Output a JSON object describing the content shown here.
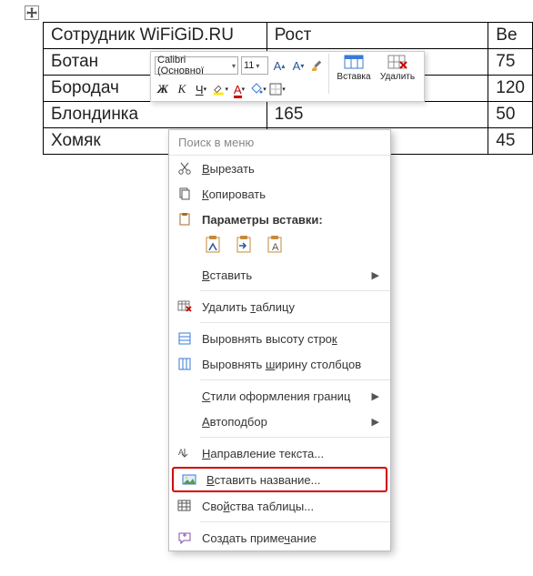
{
  "table": {
    "headers": [
      "Сотрудник WiFiGiD.RU",
      "Рост",
      "Ве"
    ],
    "rows": [
      {
        "c1": "Ботан",
        "c2": "",
        "c3": "75"
      },
      {
        "c1": "Бородач",
        "c2": "",
        "c3": "120"
      },
      {
        "c1": "Блондинка",
        "c2": "165",
        "c3": "50"
      },
      {
        "c1": "Хомяк",
        "c2": "",
        "c3": "45"
      }
    ]
  },
  "miniToolbar": {
    "font": "Calibri (Основної",
    "size": "11",
    "insert": "Вставка",
    "delete": "Удалить"
  },
  "contextMenu": {
    "search": "Поиск в меню",
    "cut": "Вырезать",
    "copy": "Копировать",
    "pasteOptionsTitle": "Параметры вставки:",
    "paste": "Вставить",
    "deleteTable": "Удалить таблицу",
    "distributeRows": "Выровнять высоту строк",
    "distributeCols": "Выровнять ширину столбцов",
    "borderStyles": "Стили оформления границ",
    "autoFit": "Автоподбор",
    "textDirection": "Направление текста...",
    "insertCaption": "Вставить название...",
    "tableProps": "Свойства таблицы...",
    "newComment": "Создать примечание"
  },
  "icons": {
    "scissors": "scissors-icon",
    "copy": "copy-icon",
    "clipboard": "clipboard-icon"
  }
}
